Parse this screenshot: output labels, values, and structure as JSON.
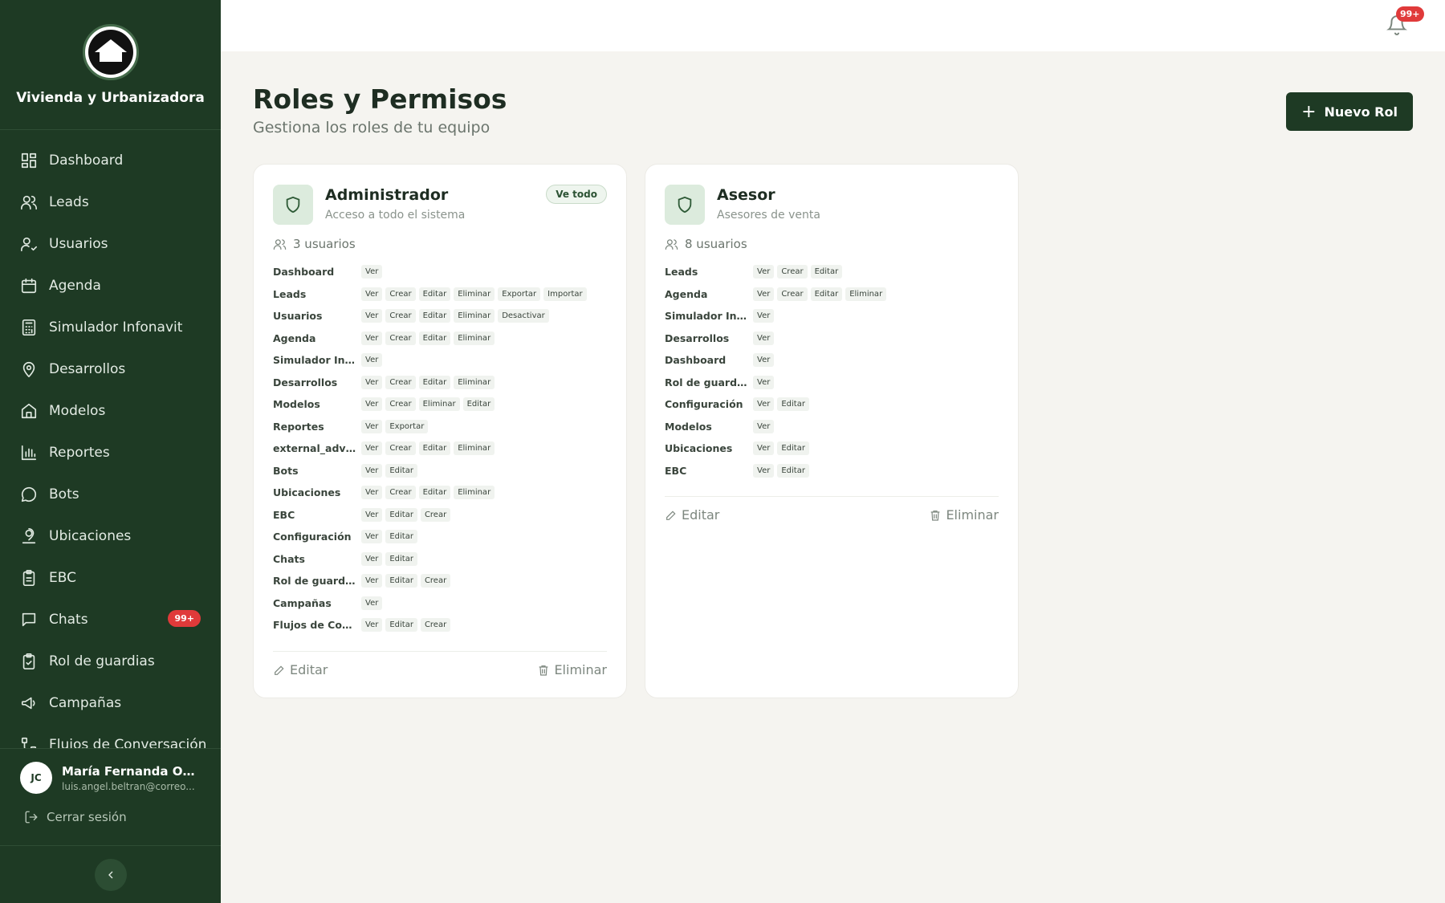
{
  "brand": {
    "name": "Vivienda y Urbanizadora"
  },
  "nav": [
    {
      "label": "Dashboard",
      "icon": "dashboard-icon"
    },
    {
      "label": "Leads",
      "icon": "users-icon"
    },
    {
      "label": "Usuarios",
      "icon": "user-check-icon"
    },
    {
      "label": "Agenda",
      "icon": "calendar-icon"
    },
    {
      "label": "Simulador Infonavit",
      "icon": "calculator-icon"
    },
    {
      "label": "Desarrollos",
      "icon": "map-pin-icon"
    },
    {
      "label": "Modelos",
      "icon": "home-icon"
    },
    {
      "label": "Reportes",
      "icon": "bar-chart-icon"
    },
    {
      "label": "Bots",
      "icon": "message-circle-icon"
    },
    {
      "label": "Ubicaciones",
      "icon": "user-location-icon"
    },
    {
      "label": "EBC",
      "icon": "clipboard-icon"
    },
    {
      "label": "Chats",
      "icon": "chat-icon",
      "badge": "99+"
    },
    {
      "label": "Rol de guardias",
      "icon": "clipboard-check-icon"
    },
    {
      "label": "Campañas",
      "icon": "megaphone-icon"
    },
    {
      "label": "Flujos de Conversación",
      "icon": "workflow-icon"
    }
  ],
  "user": {
    "initials": "JC",
    "name": "María Fernanda Orte...",
    "email": "luis.angel.beltran@correo...",
    "logout_label": "Cerrar sesión"
  },
  "topbar": {
    "notifications_badge": "99+"
  },
  "page": {
    "title": "Roles y Permisos",
    "subtitle": "Gestiona los roles de tu equipo",
    "new_role_label": "Nuevo Rol"
  },
  "roles": [
    {
      "name": "Administrador",
      "description": "Acceso a todo el sistema",
      "badge": "Ve todo",
      "users": "3 usuarios",
      "edit_label": "Editar",
      "delete_label": "Eliminar",
      "permissions": [
        {
          "module": "Dashboard",
          "actions": [
            "Ver"
          ]
        },
        {
          "module": "Leads",
          "actions": [
            "Ver",
            "Crear",
            "Editar",
            "Eliminar",
            "Exportar",
            "Importar"
          ]
        },
        {
          "module": "Usuarios",
          "actions": [
            "Ver",
            "Crear",
            "Editar",
            "Eliminar",
            "Desactivar"
          ]
        },
        {
          "module": "Agenda",
          "actions": [
            "Ver",
            "Crear",
            "Editar",
            "Eliminar"
          ]
        },
        {
          "module": "Simulador Inf...",
          "actions": [
            "Ver"
          ]
        },
        {
          "module": "Desarrollos",
          "actions": [
            "Ver",
            "Crear",
            "Editar",
            "Eliminar"
          ]
        },
        {
          "module": "Modelos",
          "actions": [
            "Ver",
            "Crear",
            "Eliminar",
            "Editar"
          ]
        },
        {
          "module": "Reportes",
          "actions": [
            "Ver",
            "Exportar"
          ]
        },
        {
          "module": "external_advi...",
          "actions": [
            "Ver",
            "Crear",
            "Editar",
            "Eliminar"
          ]
        },
        {
          "module": "Bots",
          "actions": [
            "Ver",
            "Editar"
          ]
        },
        {
          "module": "Ubicaciones",
          "actions": [
            "Ver",
            "Crear",
            "Editar",
            "Eliminar"
          ]
        },
        {
          "module": "EBC",
          "actions": [
            "Ver",
            "Editar",
            "Crear"
          ]
        },
        {
          "module": "Configuración",
          "actions": [
            "Ver",
            "Editar"
          ]
        },
        {
          "module": "Chats",
          "actions": [
            "Ver",
            "Editar"
          ]
        },
        {
          "module": "Rol de guardias",
          "actions": [
            "Ver",
            "Editar",
            "Crear"
          ]
        },
        {
          "module": "Campañas",
          "actions": [
            "Ver"
          ]
        },
        {
          "module": "Flujos de Con...",
          "actions": [
            "Ver",
            "Editar",
            "Crear"
          ]
        }
      ]
    },
    {
      "name": "Asesor",
      "description": "Asesores de venta",
      "badge": "",
      "users": "8 usuarios",
      "edit_label": "Editar",
      "delete_label": "Eliminar",
      "permissions": [
        {
          "module": "Leads",
          "actions": [
            "Ver",
            "Crear",
            "Editar"
          ]
        },
        {
          "module": "Agenda",
          "actions": [
            "Ver",
            "Crear",
            "Editar",
            "Eliminar"
          ]
        },
        {
          "module": "Simulador Inf...",
          "actions": [
            "Ver"
          ]
        },
        {
          "module": "Desarrollos",
          "actions": [
            "Ver"
          ]
        },
        {
          "module": "Dashboard",
          "actions": [
            "Ver"
          ]
        },
        {
          "module": "Rol de guardias",
          "actions": [
            "Ver"
          ]
        },
        {
          "module": "Configuración",
          "actions": [
            "Ver",
            "Editar"
          ]
        },
        {
          "module": "Modelos",
          "actions": [
            "Ver"
          ]
        },
        {
          "module": "Ubicaciones",
          "actions": [
            "Ver",
            "Editar"
          ]
        },
        {
          "module": "EBC",
          "actions": [
            "Ver",
            "Editar"
          ]
        }
      ]
    }
  ]
}
